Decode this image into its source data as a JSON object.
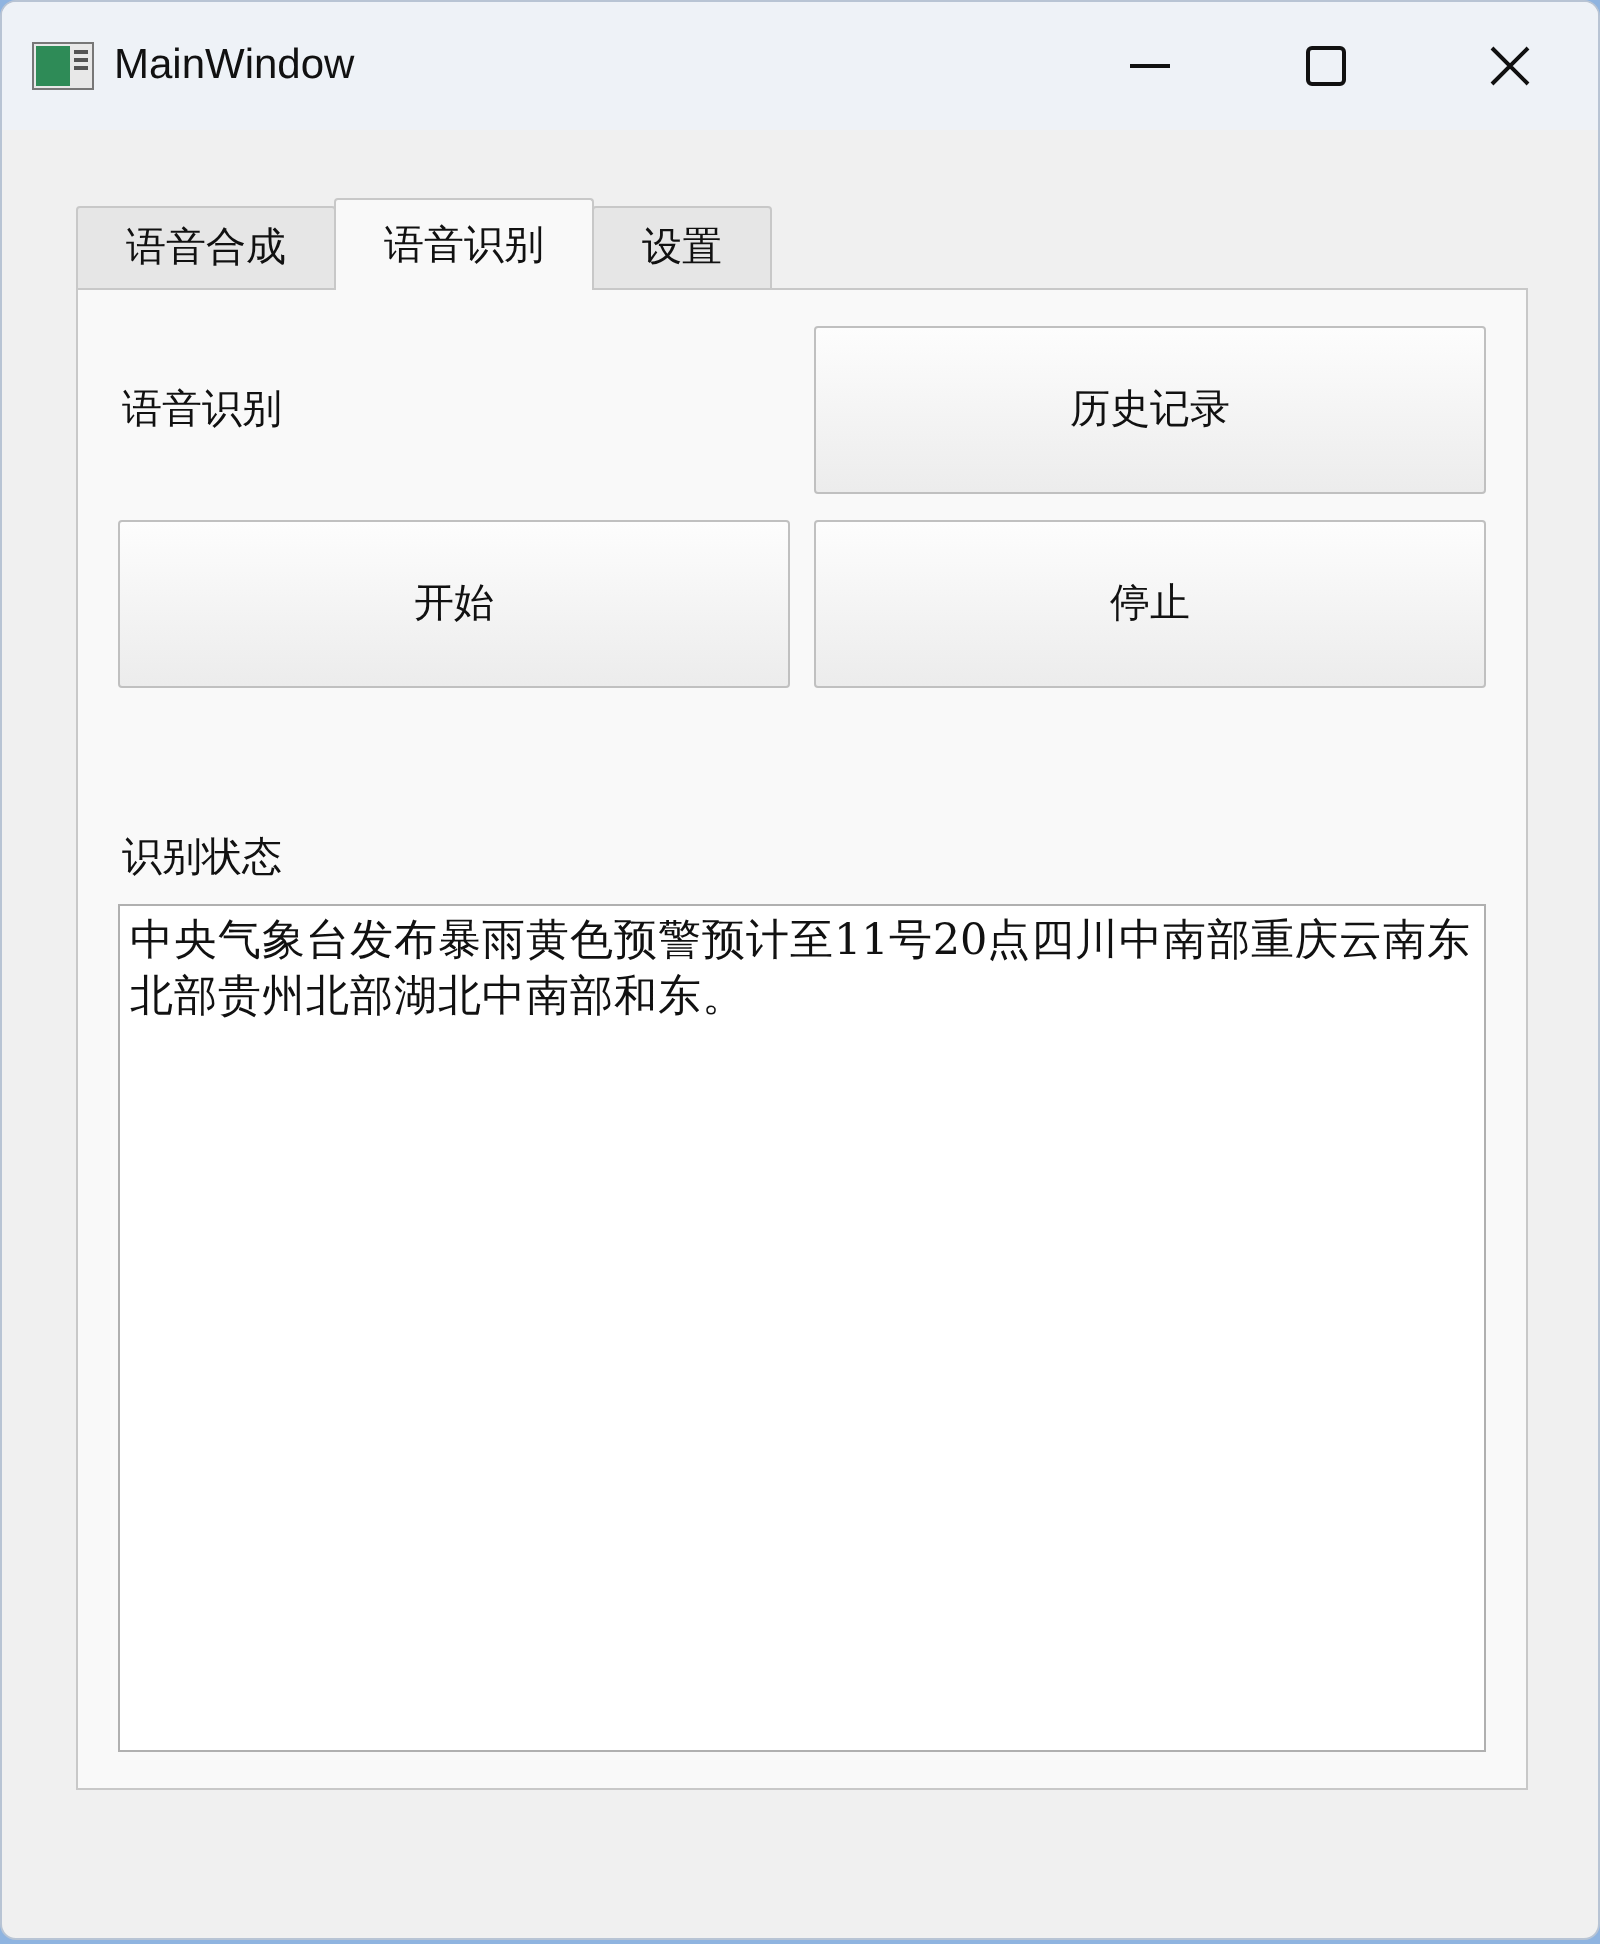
{
  "window": {
    "title": "MainWindow"
  },
  "tabs": [
    {
      "label": "语音合成",
      "selected": false
    },
    {
      "label": "语音识别",
      "selected": true
    },
    {
      "label": "设置",
      "selected": false
    }
  ],
  "section_label": "语音识别",
  "buttons": [
    {
      "kind": "history",
      "label": "历史记录"
    },
    {
      "kind": "start",
      "label": "开始"
    },
    {
      "kind": "stop",
      "label": "停止"
    }
  ],
  "status": {
    "label": "识别状态",
    "value": "中央气象台发布暴雨黄色预警预计至11号20点四川中南部重庆云南东北部贵州北部湖北中南部和东。"
  }
}
